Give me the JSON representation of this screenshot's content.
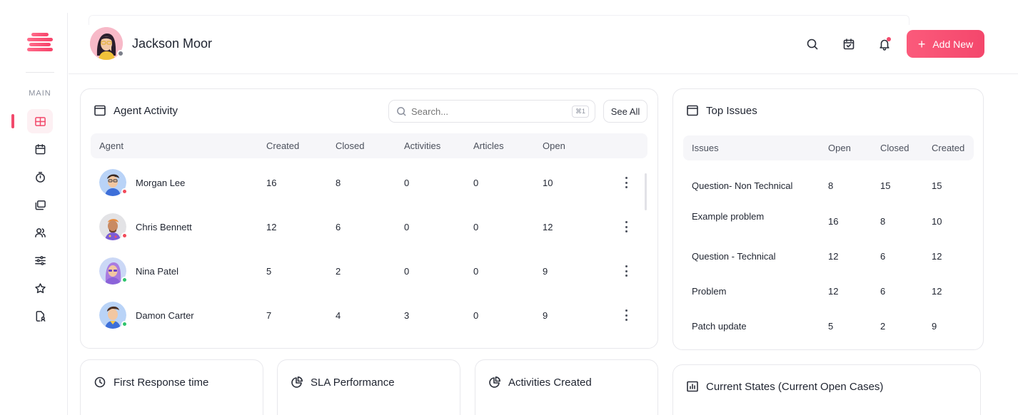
{
  "header": {
    "user_name": "Jackson Moor",
    "add_button_label": "Add New",
    "add_button_plus": "+"
  },
  "sidebar": {
    "section_label": "MAIN",
    "items": [
      {
        "icon": "grid-icon",
        "active": true
      },
      {
        "icon": "calendar-icon",
        "active": false
      },
      {
        "icon": "timer-icon",
        "active": false
      },
      {
        "icon": "folders-icon",
        "active": false
      },
      {
        "icon": "users-icon",
        "active": false
      },
      {
        "icon": "sliders-icon",
        "active": false
      },
      {
        "icon": "star-icon",
        "active": false
      },
      {
        "icon": "file-user-icon",
        "active": false
      }
    ]
  },
  "agent_activity": {
    "title": "Agent Activity",
    "search_placeholder": "Search...",
    "search_shortcut": "⌘1",
    "see_all_label": "See All",
    "columns": [
      "Agent",
      "Created",
      "Closed",
      "Activities",
      "Articles",
      "Open"
    ],
    "rows": [
      {
        "name": "Morgan Lee",
        "created": "16",
        "closed": "8",
        "activities": "0",
        "articles": "0",
        "open": "10",
        "status": "#f24a5a"
      },
      {
        "name": "Chris Bennett",
        "created": "12",
        "closed": "6",
        "activities": "0",
        "articles": "0",
        "open": "12",
        "status": "#f24a5a"
      },
      {
        "name": "Nina Patel",
        "created": "5",
        "closed": "2",
        "activities": "0",
        "articles": "0",
        "open": "9",
        "status": "#2ec46b"
      },
      {
        "name": "Damon Carter",
        "created": "7",
        "closed": "4",
        "activities": "3",
        "articles": "0",
        "open": "9",
        "status": "#2ec46b"
      }
    ]
  },
  "top_issues": {
    "title": "Top Issues",
    "columns": [
      "Issues",
      "Open",
      "Closed",
      "Created"
    ],
    "rows": [
      {
        "issue": "Question- Non Technical",
        "open": "8",
        "closed": "15",
        "created": "15"
      },
      {
        "issue": "Example problem",
        "open": "16",
        "closed": "8",
        "created": "10"
      },
      {
        "issue": "Question - Technical",
        "open": "12",
        "closed": "6",
        "created": "12"
      },
      {
        "issue": "Problem",
        "open": "12",
        "closed": "6",
        "created": "12"
      },
      {
        "issue": "Patch update",
        "open": "5",
        "closed": "2",
        "created": "9"
      }
    ]
  },
  "bottom_cards": {
    "first_response": "First Response time",
    "sla": "SLA Performance",
    "activities_created": "Activities Created",
    "current_states": "Current States (Current Open Cases)"
  },
  "colors": {
    "accent": "#f24a6c",
    "status_online": "#2ec46b",
    "status_busy": "#f24a5a",
    "status_away": "#7b7f8a"
  }
}
